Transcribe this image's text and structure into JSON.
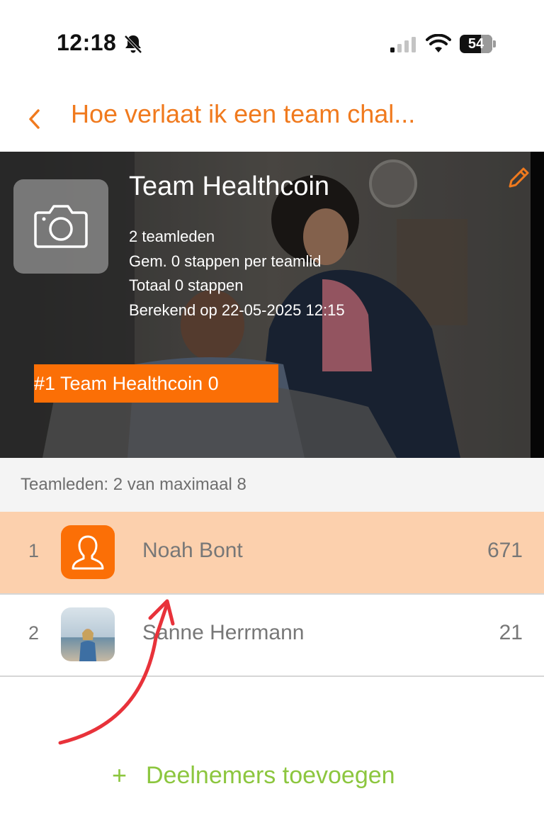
{
  "status_bar": {
    "time": "12:18",
    "battery": "54",
    "icons": [
      "bell-slash-icon",
      "signal-icon",
      "wifi-icon",
      "battery-icon"
    ]
  },
  "nav": {
    "back_icon": "chevron-left-icon",
    "title": "Hoe verlaat ik een team chal..."
  },
  "team": {
    "photo_icon": "camera-icon",
    "edit_icon": "pencil-icon",
    "name": "Team Healthcoin",
    "stats": [
      "2 teamleden",
      "Gem. 0 stappen per teamlid",
      "Totaal 0 stappen",
      "Berekend op 22-05-2025 12:15"
    ],
    "rank_badge": "#1 Team Healthcoin 0"
  },
  "members": {
    "header": "Teamleden: 2 van maximaal 8",
    "rows": [
      {
        "rank": "1",
        "name": "Noah Bont",
        "score": "671",
        "avatar": "user-placeholder-icon",
        "highlighted": true
      },
      {
        "rank": "2",
        "name": "Sanne Herrmann",
        "score": "21",
        "avatar": "profile-photo",
        "highlighted": false
      }
    ]
  },
  "add_participants": {
    "icon": "plus-icon",
    "label": "Deelnemers toevoegen"
  },
  "colors": {
    "accent_orange": "#f07a1e",
    "badge_orange": "#fb6f06",
    "highlight_row": "#fcd0ad",
    "add_green": "#8cc63e",
    "annotation_red": "#e8323a"
  }
}
